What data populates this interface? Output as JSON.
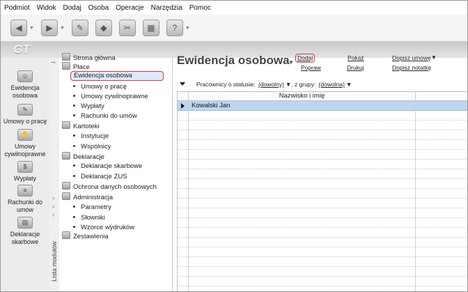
{
  "menu": [
    "Podmiot",
    "Widok",
    "Dodaj",
    "Osoba",
    "Operacje",
    "Narzędzia",
    "Pomoc"
  ],
  "toolbar": {
    "buttons": [
      {
        "icon": "back-icon",
        "glyph": "◀",
        "dropdown": true
      },
      {
        "icon": "forward-icon",
        "glyph": "▶",
        "dropdown": true
      },
      {
        "icon": "stamp-icon",
        "glyph": "✎",
        "dropdown": false
      },
      {
        "icon": "eraser-icon",
        "glyph": "◆",
        "dropdown": false
      },
      {
        "icon": "tools-icon",
        "glyph": "✂",
        "dropdown": false
      },
      {
        "icon": "calculator-icon",
        "glyph": "▦",
        "dropdown": false
      },
      {
        "icon": "help-icon",
        "glyph": "?",
        "dropdown": true
      }
    ]
  },
  "logo": "GT",
  "left_nav": [
    {
      "label": "Ewidencja osobowa",
      "icon": "people-icon"
    },
    {
      "label": "Umowy o pracę",
      "icon": "contract-icon"
    },
    {
      "label": "Umowy cywilnoprawne",
      "icon": "handshake-icon"
    },
    {
      "label": "Wypłaty",
      "icon": "payment-icon"
    },
    {
      "label": "Rachunki do umów",
      "icon": "invoice-icon"
    },
    {
      "label": "Deklaracje skarbowe",
      "icon": "declaration-icon"
    }
  ],
  "modules_label": "Lista modułów",
  "tree": {
    "strona": "Strona główna",
    "place": "Płace",
    "place_items": [
      "Ewidencja osobowa",
      "Umowy o pracę",
      "Umowy cywilnoprawne",
      "Wypłaty",
      "Rachunki do umów"
    ],
    "kartoteki": "Kartoteki",
    "kartoteki_items": [
      "Instytucje",
      "Wspólnicy"
    ],
    "deklaracje": "Deklaracje",
    "deklaracje_items": [
      "Deklaracje skarbowe",
      "Deklaracje ZUS"
    ],
    "ochrona": "Ochrona danych osobowych",
    "administracja": "Administracja",
    "administracja_items": [
      "Parametry",
      "Słowniki",
      "Wzorce wydruków"
    ],
    "zestawienia": "Zestawienia",
    "selected": "Ewidencja osobowa"
  },
  "content": {
    "title": "Ewidencja osobowa",
    "actions": {
      "dodaj": "Dodaj",
      "popraw": "Popraw",
      "pokaz": "Pokaż",
      "drukuj": "Drukuj",
      "dopisz_umowe": "Dopisz umowę",
      "dopisz_notatke": "Dopisz notatkę"
    },
    "filter": {
      "label1": "Pracownicy o statusie:",
      "status_value": "(dowolny)",
      "label2": ", z grupy:",
      "group_value": "(dowolna)"
    },
    "grid": {
      "column": "Nazwisko i imię",
      "rows": [
        "Kowalski Jan"
      ]
    }
  }
}
